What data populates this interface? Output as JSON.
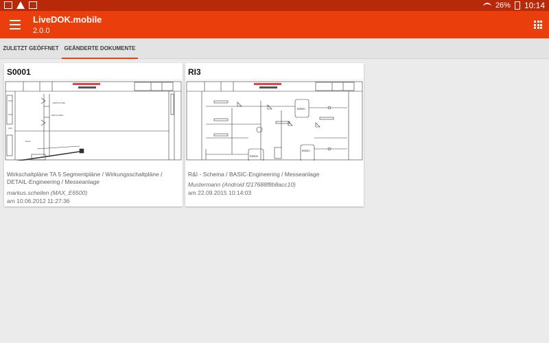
{
  "statusbar": {
    "battery": "26%",
    "time": "10:14"
  },
  "appbar": {
    "title": "LiveDOK.mobile",
    "version": "2.0.0"
  },
  "tabs": [
    {
      "label": "ZULETZT GEÖFFNET",
      "active": false
    },
    {
      "label": "GEÄNDERTE DOKUMENTE",
      "active": true
    }
  ],
  "documents": [
    {
      "title": "S0001",
      "description": "Wirkschaltpläne TA 5 Segmentpläne / Wirkungsschaltpläne / DETAIL-Engineering / Messeanlage",
      "author": "markus.scheilen (MAX_E6500)",
      "date": "am 10.06.2012 11:27:36"
    },
    {
      "title": "RI3",
      "description": "R&I - Schema / BASIC-Engineering / Messeanlage",
      "author": "Mustermann (Android f217688f8b8acc10)",
      "date": "am 22.09.2015 10:14:03",
      "thumb_labels": {
        "vessel_1": "B3000",
        "vessel_2": "R3000",
        "vessel_3": "B3001"
      }
    }
  ],
  "colors": {
    "statusbar": "#b8290a",
    "appbar": "#ea3e0c",
    "tab_indicator": "#ea3e0c",
    "background": "#ebebeb"
  }
}
